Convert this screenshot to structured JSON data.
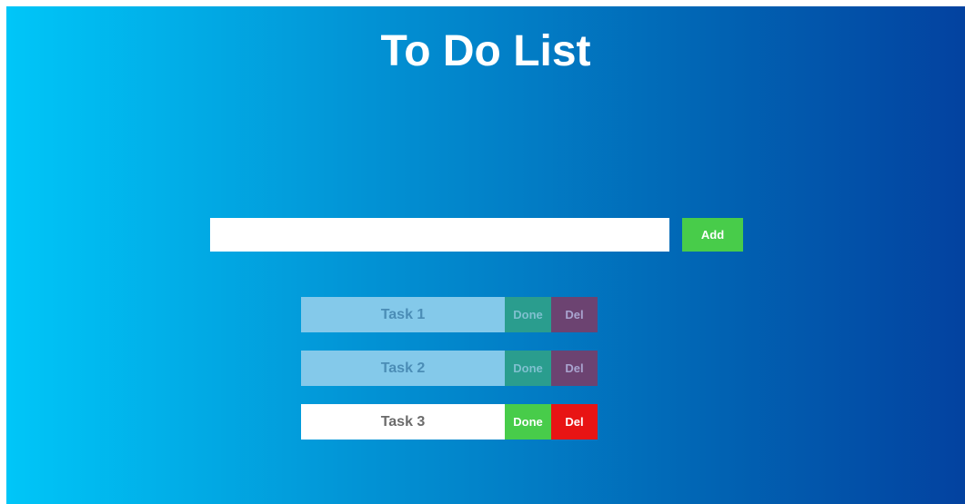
{
  "header": {
    "title": "To Do List"
  },
  "input": {
    "value": "",
    "placeholder": ""
  },
  "add_button": {
    "label": "Add"
  },
  "tasks": [
    {
      "label": "Task 1",
      "done_label": "Done",
      "del_label": "Del",
      "completed": true
    },
    {
      "label": "Task 2",
      "done_label": "Done",
      "del_label": "Del",
      "completed": true
    },
    {
      "label": "Task 3",
      "done_label": "Done",
      "del_label": "Del",
      "completed": false
    }
  ],
  "colors": {
    "gradient_start": "#00c6f8",
    "gradient_end": "#0342a0",
    "add_green": "#48cc4a",
    "done_green": "#48cc4a",
    "del_red": "#e81414"
  }
}
